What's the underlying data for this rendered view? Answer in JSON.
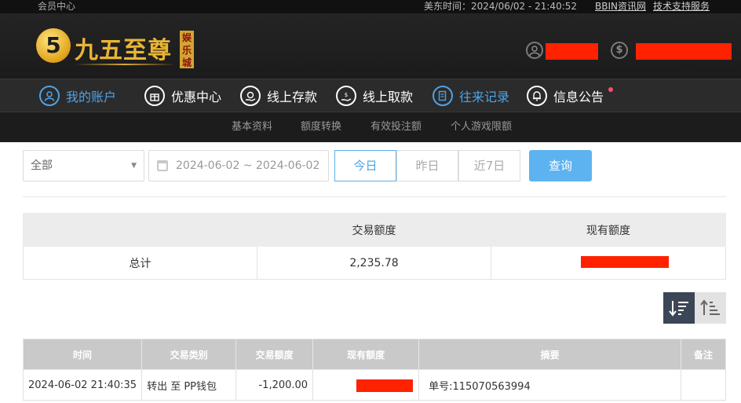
{
  "topbar": {
    "member_center": "会员中心",
    "clock": "美东时间：2024/06/02 - 21:40:52",
    "bbin_news": "BBIN资讯网",
    "tech_support": "技术支持服务"
  },
  "header": {
    "logo_mark": "5",
    "logo_text": "九五至尊",
    "logo_badge": "娱乐城",
    "user_icon": "user-circle-icon",
    "balance_icon": "dollar-circle-icon"
  },
  "nav": {
    "items": [
      {
        "label": "我的账户",
        "icon": "user-icon",
        "active": true
      },
      {
        "label": "优惠中心",
        "icon": "gift-icon",
        "active": false
      },
      {
        "label": "线上存款",
        "icon": "deposit-icon",
        "active": false
      },
      {
        "label": "线上取款",
        "icon": "withdraw-icon",
        "active": false
      },
      {
        "label": "往来记录",
        "icon": "record-icon",
        "active": true
      },
      {
        "label": "信息公告",
        "icon": "bell-icon",
        "active": false
      }
    ]
  },
  "subnav": {
    "items": [
      "基本资料",
      "额度转换",
      "有效投注额",
      "个人游戏限额"
    ]
  },
  "filters": {
    "type_selected": "全部",
    "date_range": "2024-06-02 ~ 2024-06-02",
    "quick_today": "今日",
    "quick_yesterday": "昨日",
    "quick_7days": "近7日",
    "query_button": "查询"
  },
  "summary": {
    "headers": [
      "",
      "交易额度",
      "现有额度"
    ],
    "row_label": "总计",
    "total_amount": "2,235.78"
  },
  "records": {
    "headers": [
      "时间",
      "交易类别",
      "交易额度",
      "现有额度",
      "摘要",
      "备注"
    ],
    "rows": [
      {
        "time": "2024-06-02 21:40:35",
        "type": "转出 至 PP钱包",
        "amount": "-1,200.00",
        "summary": "单号:115070563994",
        "note": ""
      }
    ]
  },
  "colors": {
    "accent_blue": "#4fa3e6",
    "query_button": "#5db3f0",
    "redaction": "#ff2200",
    "gold": "#e9b533"
  }
}
